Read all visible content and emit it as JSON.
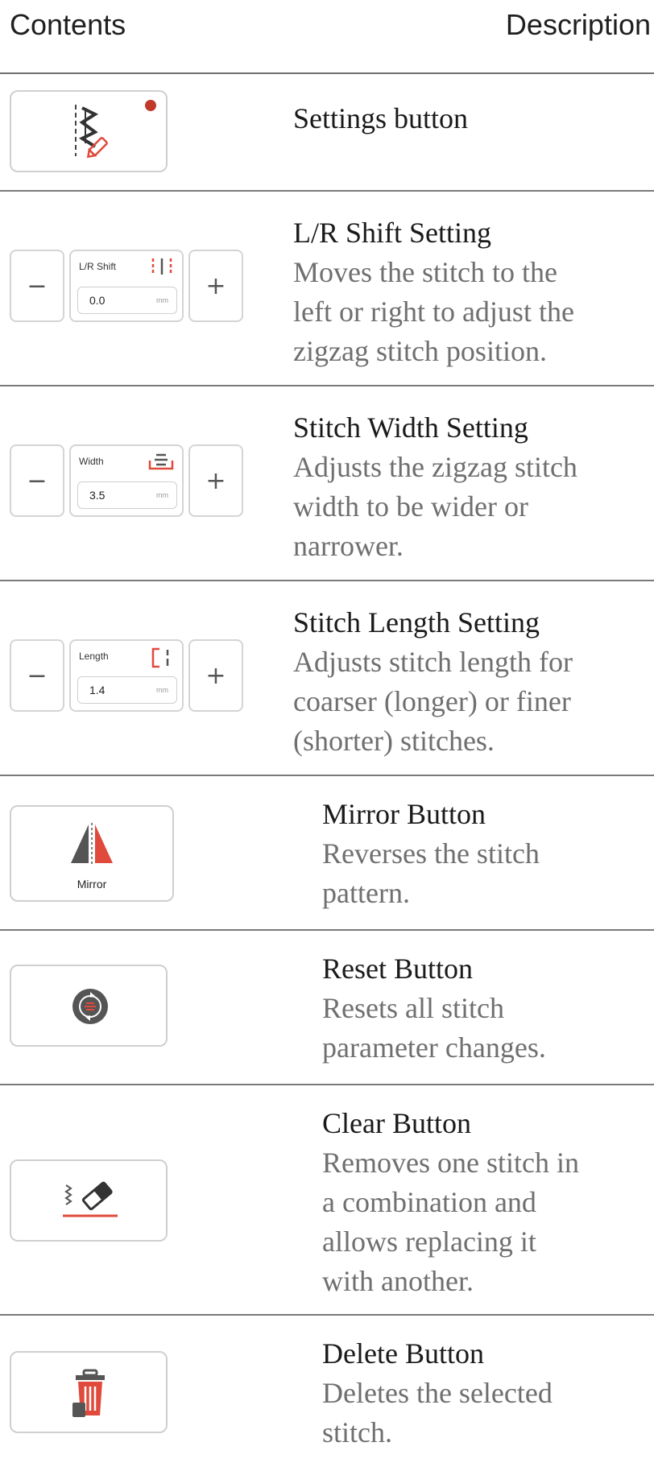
{
  "header": {
    "contents": "Contents",
    "description": "Description"
  },
  "rows": {
    "settings": {
      "title": "Settings button"
    },
    "lr_shift": {
      "title": "L/R Shift Setting",
      "desc": [
        "Moves the stitch to the",
        "left or right to adjust the",
        "zigzag stitch position."
      ],
      "label": "L/R Shift",
      "value": "0.0",
      "unit": "mm",
      "minus": "−",
      "plus": "+"
    },
    "width": {
      "title": "Stitch Width Setting",
      "desc": [
        "Adjusts the zigzag stitch",
        "width to be wider or",
        "narrower."
      ],
      "label": "Width",
      "value": "3.5",
      "unit": "mm",
      "minus": "−",
      "plus": "+"
    },
    "length": {
      "title": "Stitch Length Setting",
      "desc": [
        "Adjusts stitch length for",
        "coarser (longer) or finer",
        "(shorter) stitches."
      ],
      "label": "Length",
      "value": "1.4",
      "unit": "mm",
      "minus": "−",
      "plus": "+"
    },
    "mirror": {
      "title": "Mirror Button",
      "desc": [
        "Reverses the stitch",
        "pattern."
      ],
      "label": "Mirror"
    },
    "reset": {
      "title": "Reset Button",
      "desc": [
        "Resets all stitch",
        "parameter changes."
      ]
    },
    "clear": {
      "title": "Clear Button",
      "desc": [
        "Removes one stitch in",
        "a combination and",
        "allows replacing it",
        "with another."
      ]
    },
    "delete": {
      "title": "Delete Button",
      "desc": [
        "Deletes the selected",
        "stitch."
      ]
    }
  },
  "icons": {
    "settings": "zigzag-stitch-pencil-icon",
    "lr_shift": "lr-shift-icon",
    "width": "width-icon",
    "length": "length-icon",
    "mirror": "mirror-icon",
    "reset": "reset-icon",
    "clear": "eraser-icon",
    "delete": "trash-icon"
  },
  "colors": {
    "accent": "#e04a3c",
    "dark": "#555555",
    "notification_dot": "#c0392b"
  }
}
